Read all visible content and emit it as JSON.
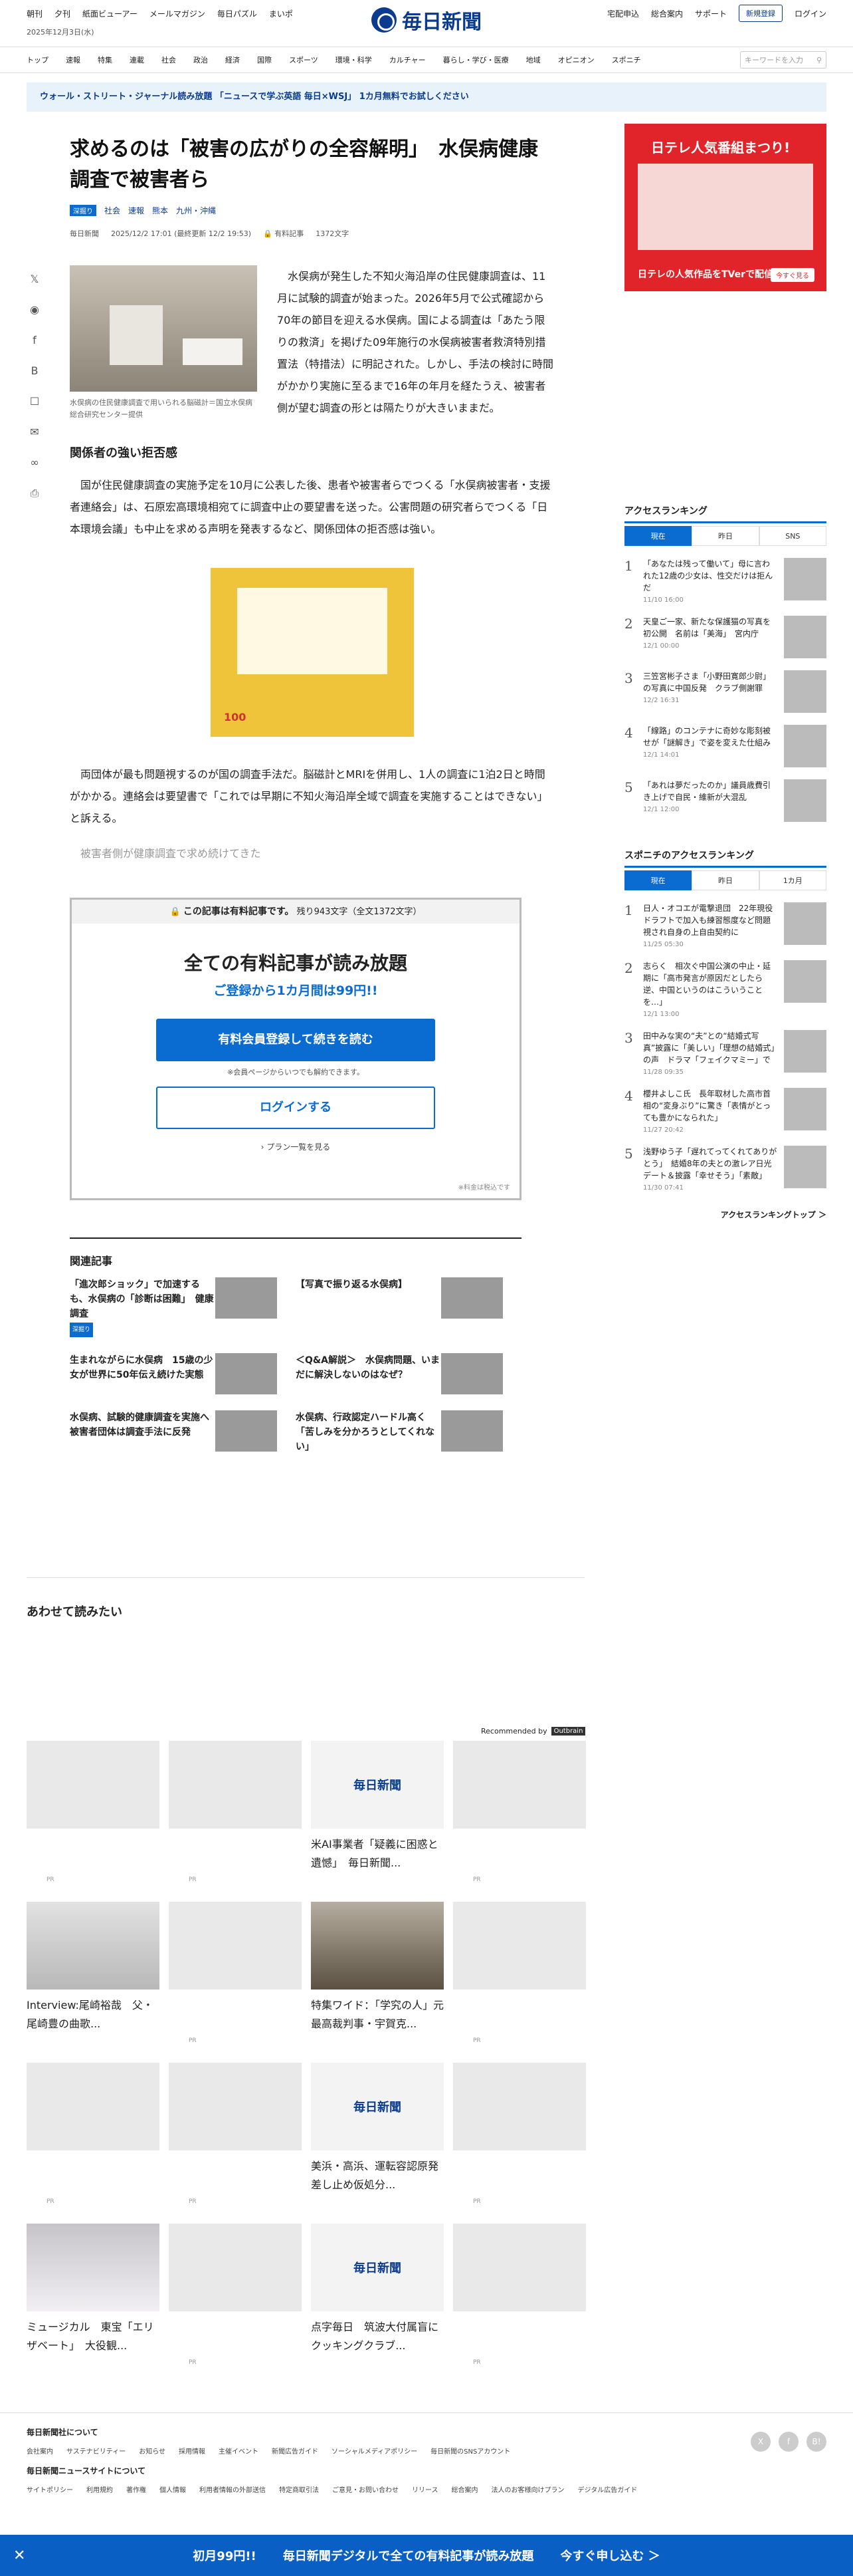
{
  "header": {
    "left_links": [
      "朝刊",
      "夕刊",
      "紙面ビューアー",
      "メールマガジン",
      "毎日パズル",
      "まいポ"
    ],
    "logo_text": "毎日新聞",
    "right_links": [
      "宅配申込",
      "総合案内",
      "サポート"
    ],
    "subscribe_label": "新規登録",
    "login_label": "ログイン",
    "date": "2025年12月3日(水)"
  },
  "nav": {
    "items": [
      "トップ",
      "速報",
      "特集",
      "連載",
      "社会",
      "政治",
      "経済",
      "国際",
      "スポーツ",
      "環境・科学",
      "カルチャー",
      "暮らし・学び・医療",
      "地域",
      "オピニオン",
      "スポニチ"
    ],
    "search_placeholder": "キーワードを入力"
  },
  "notice": "ウォール・ストリート・ジャーナル読み放題 「ニュースで学ぶ英語 毎日×WSJ」 1カ月無料でお試しください",
  "article": {
    "title": "求めるのは「被害の広がりの全容解明」　水俣病健康調査で被害者ら",
    "tags": [
      "深掘り",
      "社会",
      "速報",
      "熊本",
      "九州・沖縄"
    ],
    "source": "毎日新聞",
    "date": "2025/12/2 17:01 (最終更新 12/2 19:53)",
    "paid_label": "有料記事",
    "char_count": "1372文字",
    "photo_caption": "水俣病の住民健康調査で用いられる脳磁計＝国立水俣病総合研究センター提供",
    "lead": "水俣病が発生した不知火海沿岸の住民健康調査は、11月に試験的調査が始まった。2026年5月で公式確認から70年の節目を迎える水俣病。国による調査は「あたう限りの救済」を掲げた09年施行の水俣病被害者救済特別措置法（特措法）に明記された。しかし、手法の検討に時間がかかり実施に至るまで16年の年月を経たうえ、被害者側が望む調査の形とは隔たりが大きいままだ。",
    "subheading": "関係者の強い拒否感",
    "para2": "国が住民健康調査の実施予定を10月に公表した後、患者や被害者らでつくる「水俣病被害者・支援者連絡会」は、石原宏高環境相宛てに調査中止の要望書を送った。公害問題の研究者らでつくる「日本環境会議」も中止を求める声明を発表するなど、関係団体の拒否感は強い。",
    "ad_text": "100",
    "para3": "両団体が最も問題視するのが国の調査手法だ。脳磁計とMRIを併用し、1人の調査に1泊2日と時間がかかる。連絡会は要望書で「これでは早期に不知火海沿岸全域で調査を実施することはできない」と訴える。",
    "para4": "被害者側が健康調査で求め続けてきた"
  },
  "paywall": {
    "head": "この記事は有料記事です。",
    "remaining": "残り943文字（全文1372文字）",
    "title": "全ての有料記事が読み放題",
    "sub": "ご登録から1カ月間は99円!!",
    "register_btn": "有料会員登録して続きを読む",
    "note": "※会員ページからいつでも解約できます。",
    "login_btn": "ログインする",
    "plan_link": "プラン一覧を見る",
    "tax": "※料金は税込です"
  },
  "related": {
    "heading": "関連記事",
    "items": [
      {
        "title": "「進次郎ショック」で加速するも、水俣病の「診断は困難」　健康調査",
        "badge": "深掘り"
      },
      {
        "title": "【写真で振り返る水俣病】",
        "badge": ""
      },
      {
        "title": "生まれながらに水俣病　15歳の少女が世界に50年伝え続けた実態",
        "badge": ""
      },
      {
        "title": "＜Q&A解説＞　水俣病問題、いまだに解決しないのはなぜ？",
        "badge": ""
      },
      {
        "title": "水俣病、試験的健康調査を実施へ　被害者団体は調査手法に反発",
        "badge": ""
      },
      {
        "title": "水俣病、行政認定ハードル高く「苦しみを分かろうとしてくれない」",
        "badge": ""
      }
    ]
  },
  "recommend": {
    "heading": "あわせて読みたい",
    "by": "Recommended by",
    "by_badge": "Outbrain",
    "cards": [
      {
        "title": "",
        "pr": "PR"
      },
      {
        "title": "",
        "pr": "PR"
      },
      {
        "title": "米AI事業者「疑義に困惑と遺憾」　毎日新聞...",
        "pr": ""
      },
      {
        "title": "",
        "pr": "PR"
      },
      {
        "title": "Interview:尾崎裕哉　父・尾崎豊の曲歌...",
        "pr": ""
      },
      {
        "title": "",
        "pr": "PR"
      },
      {
        "title": "特集ワイド：「学究の人」元最高裁判事・宇賀克...",
        "pr": ""
      },
      {
        "title": "",
        "pr": "PR"
      },
      {
        "title": "",
        "pr": "PR"
      },
      {
        "title": "",
        "pr": "PR"
      },
      {
        "title": "美浜・高浜、運転容認原発差し止め仮処分...",
        "pr": ""
      },
      {
        "title": "",
        "pr": "PR"
      },
      {
        "title": "ミュージカル　東宝「エリザベート」　大役観...",
        "pr": ""
      },
      {
        "title": "",
        "pr": "PR"
      },
      {
        "title": "点字毎日　筑波大付属盲にクッキングクラブ...",
        "pr": ""
      },
      {
        "title": "",
        "pr": "PR"
      }
    ]
  },
  "sidebar": {
    "ad_title": "日テレ人気番組まつり!",
    "ad_bottom": "日テレの人気作品をTVerで配信中",
    "ad_cta": "今すぐ見る",
    "ranking_heading": "アクセスランキング",
    "ranking_tabs": [
      "現在",
      "昨日",
      "SNS"
    ],
    "ranking": [
      {
        "n": "1",
        "text": "「あなたは残って働いて」母に言われた12歳の少女は、性交だけは拒んだ",
        "time": "11/10 16:00"
      },
      {
        "n": "2",
        "text": "天皇ご一家、新たな保護猫の写真を初公開　名前は「美海」　宮内庁",
        "time": "12/1 00:00"
      },
      {
        "n": "3",
        "text": "三笠宮彬子さま「小野田寛郎少尉」の写真に中国反発　クラブ側謝罪",
        "time": "12/2 16:31"
      },
      {
        "n": "4",
        "text": "「線路」のコンテナに奇妙な彫刻被せが「謎解き」で姿を変えた仕組み",
        "time": "12/1 14:01"
      },
      {
        "n": "5",
        "text": "「あれは夢だったのか」議員歳費引き上げで自民・維新が大混乱",
        "time": "12/1 12:00"
      }
    ],
    "sponichi_heading": "スポニチのアクセスランキング",
    "sponichi_tabs": [
      "現在",
      "昨日",
      "1カ月"
    ],
    "sponichi": [
      {
        "n": "1",
        "text": "日人・オコエが電撃退団　22年現役ドラフトで加入も練習態度など問題視され自身の上自由契約に",
        "time": "11/25 05:30"
      },
      {
        "n": "2",
        "text": "志らく　相次ぐ中国公演の中止・延期に「高市発言が原因だとしたら逆、中国というのはこういうことを…」",
        "time": "12/1 13:00"
      },
      {
        "n": "3",
        "text": "田中みな実の“夫”との“結婚式写真”披露に「美しい」「理想の結婚式」の声　ドラマ「フェイクマミー」で",
        "time": "11/28 09:35"
      },
      {
        "n": "4",
        "text": "櫻井よしこ氏　長年取材した高市首相の“変身ぶり”に驚き「表情がとっても豊かになられた」",
        "time": "11/27 20:42"
      },
      {
        "n": "5",
        "text": "浅野ゆう子「遅れてってくれてありがとう」　結婚8年の夫との激レア日光デート＆披露「幸せそう」「素敵」",
        "time": "11/30 07:41"
      }
    ],
    "more": "アクセスランキングトップ ＞"
  },
  "footer": {
    "about": "毎日新聞社について",
    "about_links": [
      "会社案内",
      "サステナビリティー",
      "お知らせ",
      "採用情報",
      "主催イベント",
      "新聞広告ガイド",
      "ソーシャルメディアポリシー",
      "毎日新聞のSNSアカウント"
    ],
    "site": "毎日新聞ニュースサイトについて",
    "site_links": [
      "サイトポリシー",
      "利用規約",
      "著作権",
      "個人情報",
      "利用者情報の外部送信",
      "特定商取引法",
      "ご意見・お問い合わせ",
      "リリース",
      "総合案内",
      "法人のお客様向けプラン",
      "デジタル広告ガイド"
    ]
  },
  "bottom_banner": {
    "price": "初月99円!!",
    "text": "毎日新聞デジタルで全ての有料記事が読み放題",
    "cta": "今すぐ申し込む ＞"
  }
}
